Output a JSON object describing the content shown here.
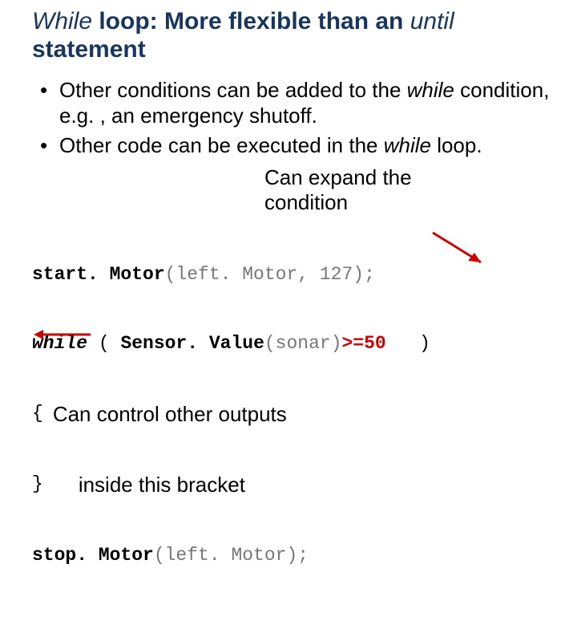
{
  "title": {
    "prefix_italic": "While",
    "mid": " loop: More flexible than an ",
    "suffix_italic": "until",
    "tail": " statement"
  },
  "bullets": [
    {
      "pre": "Other conditions can be added to the ",
      "italic": "while",
      "post": " condition, e.g. , an emergency shutoff."
    },
    {
      "pre": "Other code can be executed in the ",
      "italic": "while",
      "post": " loop."
    }
  ],
  "annot_expand": "Can expand the condition",
  "annot_bracket_l1": "Can control other outputs",
  "annot_bracket_l2": "inside this bracket",
  "code": {
    "l1_fn": "start. Motor",
    "l1_args": "(left. Motor, 127);",
    "l2_kw": "while",
    "l2_open": " ( ",
    "l2_sensor": "Sensor. Value",
    "l2_sarg": "(sonar)",
    "l2_cmp": ">=50",
    "l2_close": "   )",
    "l3_brace_open": "{",
    "l4_brace_close": "}",
    "l5_fn": "stop. Motor",
    "l5_args": "(left. Motor);"
  }
}
